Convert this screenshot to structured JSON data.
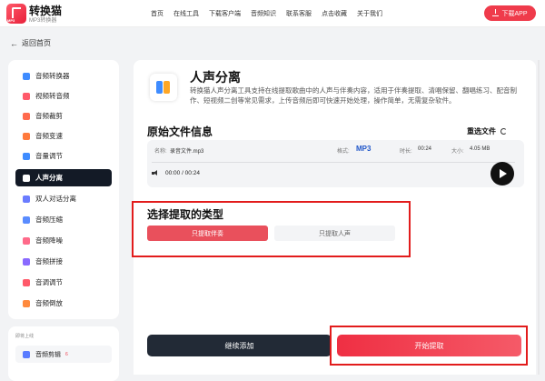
{
  "brand": {
    "name": "转换猫",
    "subtitle": "MP3转换器",
    "logo_caption": "MP3"
  },
  "nav": [
    "首页",
    "在线工具",
    "下载客户端",
    "音频知识",
    "联系客服",
    "点击收藏",
    "关于我们"
  ],
  "download_button": {
    "label": "下载APP",
    "icon": "download-icon"
  },
  "back": {
    "label": "返回首页",
    "icon": "arrow-left-icon"
  },
  "sidebar": {
    "items": [
      {
        "label": "音频转换器",
        "color": "#3f8cff"
      },
      {
        "label": "视频转音频",
        "color": "#ff5a6a"
      },
      {
        "label": "音频裁剪",
        "color": "#ff6a4d"
      },
      {
        "label": "音频变速",
        "color": "#ff7a3d"
      },
      {
        "label": "音量调节",
        "color": "#3f8cff"
      },
      {
        "label": "人声分离",
        "color": "#ffffff"
      },
      {
        "label": "双人对话分离",
        "color": "#6a7cff"
      },
      {
        "label": "音频压缩",
        "color": "#5a8cff"
      },
      {
        "label": "音频降噪",
        "color": "#ff6a8a"
      },
      {
        "label": "音频拼接",
        "color": "#8a6aff"
      },
      {
        "label": "音调调节",
        "color": "#ff5a6a"
      },
      {
        "label": "音频倒放",
        "color": "#ff8a3d"
      }
    ],
    "active_index": 5
  },
  "sidebar2": {
    "title": "即将上线",
    "item": {
      "label": "音频剪辑",
      "badge": "6"
    }
  },
  "tool": {
    "title": "人声分离",
    "description": "转换猫人声分离工具支持在线提取歌曲中的人声与伴奏内容，适用于伴奏提取、清唱保留、翻唱练习、配音制作、短视频二创等常见需求，上传音频后即可快速开始处理，操作简单，无需复杂软件。"
  },
  "original_file": {
    "section_title": "原始文件信息",
    "reselect_label": "重选文件",
    "name_label": "名称:",
    "name_value": "录音文件.mp3",
    "format_label": "格式:",
    "format_value": "MP3",
    "duration_label": "时长:",
    "duration_value": "00:24",
    "size_label": "大小:",
    "size_value": "4.05 MB",
    "player_time": "00:00 / 00:24"
  },
  "extract": {
    "title": "选择提取的类型",
    "option_accompaniment": "只提取伴奏",
    "option_vocals": "只提取人声",
    "selected": "只提取伴奏"
  },
  "actions": {
    "continue_add": "继续添加",
    "start_extract": "开始提取"
  },
  "colors": {
    "accent": "#ef3b4b",
    "dark": "#131a26",
    "highlight_box": "#e21c1c",
    "format": "#2056c9"
  }
}
